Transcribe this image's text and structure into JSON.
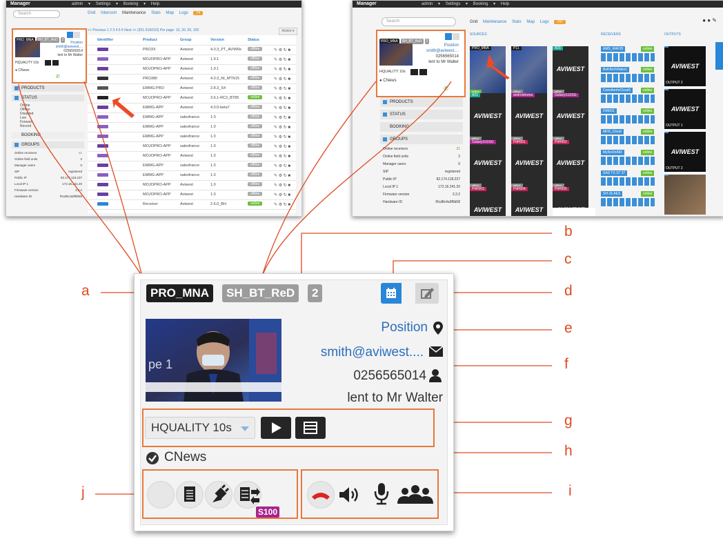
{
  "app": {
    "title": "Manager",
    "menu": [
      "admin",
      "Settings",
      "Booking",
      "Help"
    ],
    "search_placeholder": "Search"
  },
  "left_shot": {
    "tabs": [
      "Grid",
      "Intercom",
      "Maintenance",
      "Stats",
      "Map",
      "Logs"
    ],
    "logs_badge": "74",
    "pager": "<< Previous 1 2 3 4 5 6 Next >> (301-318/103) Per page: 10, 20, 50, 100",
    "columns": [
      "Identifier",
      "Product",
      "Group",
      "Version",
      "Status"
    ],
    "rows": [
      {
        "product": "PRO3X",
        "group": "Aviwest",
        "version": "4.0.3_PT_AVIW0e",
        "status": "offline"
      },
      {
        "product": "MOJOPRO-APP",
        "group": "Aviwest",
        "version": "1.9.1",
        "status": "offline"
      },
      {
        "product": "MOJOPRO-APP",
        "group": "Aviwest",
        "version": "1.9.1",
        "status": "offline"
      },
      {
        "product": "PRO380",
        "group": "Aviwest",
        "version": "4.0.3_NI_MTN15",
        "status": "offline"
      },
      {
        "product": "EMMG-PRO",
        "group": "Aviwest",
        "version": "2.8.3_S4",
        "status": "offline"
      },
      {
        "product": "MOJOPRO-APP",
        "group": "Aviwest",
        "version": "3.6.1-RC2_BT85",
        "status": "online"
      },
      {
        "product": "EMMG-APP",
        "group": "Aviwest",
        "version": "4.0.0-beta7",
        "status": "offline"
      },
      {
        "product": "EMMG-APP",
        "group": "salesfrance",
        "version": "1.0",
        "status": "offline"
      },
      {
        "product": "EMMG-APP",
        "group": "salesfrance",
        "version": "1.0",
        "status": "offline"
      },
      {
        "product": "EMMG-APP",
        "group": "salesfrance",
        "version": "1.0",
        "status": "offline"
      },
      {
        "product": "MOJOPRO-APP",
        "group": "salesfrance",
        "version": "1.0",
        "status": "offline"
      },
      {
        "product": "MOJOPRO-APP",
        "group": "Aviwest",
        "version": "1.0",
        "status": "offline"
      },
      {
        "product": "EMMG-APP",
        "group": "salesfrance",
        "version": "1.0",
        "status": "offline"
      },
      {
        "product": "EMMG-APP",
        "group": "salesfrance",
        "version": "1.0",
        "status": "offline"
      },
      {
        "product": "MOJOPRO-APP",
        "group": "Aviwest",
        "version": "1.0",
        "status": "offline"
      },
      {
        "product": "MOJOPRO-APP",
        "group": "Aviwest",
        "version": "1.0",
        "status": "offline"
      },
      {
        "product": "Receiver",
        "group": "Aviwest",
        "version": "2.6.0_BH",
        "status": "online"
      }
    ],
    "sidebar": {
      "sections": [
        "PRODUCTS",
        "STATUS",
        "BOOKING",
        "GROUPS"
      ],
      "status_items": [
        "Online",
        "Offline",
        "Disabled",
        "Live",
        "Forward",
        "Record"
      ],
      "stats": [
        {
          "label": "Online receivers",
          "value": "21"
        },
        {
          "label": "Online field units",
          "value": "2"
        },
        {
          "label": "Manager users",
          "value": "0"
        },
        {
          "label": "SIP",
          "value": "registered"
        },
        {
          "label": "Public IP",
          "value": "82.174.118.237"
        },
        {
          "label": "Local IP 1",
          "value": "172.16.241.20"
        },
        {
          "label": "Firmware version",
          "value": "3.3.2"
        },
        {
          "label": "Hardware ID",
          "value": "f0cd8c4a9f6b58"
        }
      ]
    }
  },
  "right_shot": {
    "tabs": [
      "Grid",
      "Maintenance",
      "Stats",
      "Map",
      "Logs"
    ],
    "logs_badge": "707",
    "sources_header": "SOURCES",
    "receivers_header": "RECEIVERS",
    "outputs_header": "OUTPUTS",
    "sources": [
      "PRO_MNA",
      "P11",
      "A21",
      "A21",
      "androidnews",
      "GalaxyS10SG",
      "GalaxyS10SG",
      "PitH001",
      "PitH002",
      "PitH003",
      "PitH004",
      "PitH005",
      "PitH102",
      "PitH103",
      "PitH104"
    ],
    "receivers": [
      "AMS_RAF28",
      "BuKArchVideo1",
      "ConnibertoCloud1",
      "DMU01",
      "MFR_Cloud",
      "MyRxOnAIR",
      "SAS TS ST 37",
      "SH-16 AES"
    ],
    "outputs": [
      "OUTPUT 2",
      "OUTPUT 1",
      "OUTPUT 2",
      ""
    ],
    "sidebar": {
      "sections": [
        "PRODUCTS",
        "STATUS",
        "BOOKING",
        "GROUPS"
      ],
      "stats": [
        {
          "label": "Online receivers",
          "value": "21"
        },
        {
          "label": "Online field units",
          "value": "2"
        },
        {
          "label": "Manager users",
          "value": "0"
        },
        {
          "label": "SIP",
          "value": "registered"
        },
        {
          "label": "Public IP",
          "value": "82.174.118.237"
        },
        {
          "label": "Local IP 1",
          "value": "172.16.241.20"
        },
        {
          "label": "Firmware version",
          "value": "3.3.2"
        },
        {
          "label": "Hardware ID",
          "value": "f0cd8c4a9f6b58"
        }
      ]
    }
  },
  "unit_card": {
    "name_label": "PRO_MNA",
    "secondary_label": "SH_BT_ReD",
    "count_badge": "2",
    "position_link": "Position",
    "email": "smith@aviwest....",
    "phone": "0256565014",
    "lent_to": "lent to Mr Walter",
    "profile_select": "HQUALITY 10s",
    "channel": "CNews",
    "sim_badge": "S100",
    "colors": {
      "accent": "#2a86d6",
      "callout": "#e04a20",
      "dark_label": "#222222",
      "grey_label": "#9c9c9c"
    }
  },
  "callouts": [
    "a",
    "b",
    "c",
    "d",
    "e",
    "f",
    "g",
    "h",
    "i",
    "j"
  ]
}
